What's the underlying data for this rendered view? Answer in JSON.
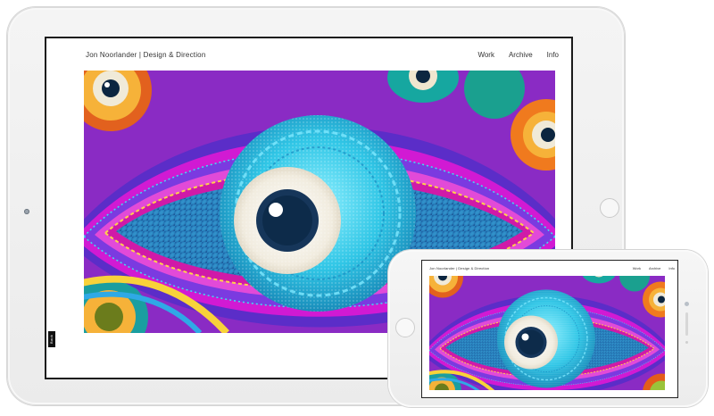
{
  "site": {
    "title": "Jon Noorlander | Design & Direction",
    "nav": [
      "Work",
      "Archive",
      "Info"
    ]
  },
  "tablet": {
    "side_tab_label": "Back"
  },
  "hero": {
    "description_icon": "woven-textile-eye-artwork",
    "colors": {
      "magenta": "#c21bd2",
      "purple": "#6c2bd8",
      "cyan": "#39c4e8",
      "blue": "#1f6fb8",
      "orange": "#f07a1e",
      "teal": "#1a9ea0",
      "pupil": "#0d2b4a"
    }
  }
}
